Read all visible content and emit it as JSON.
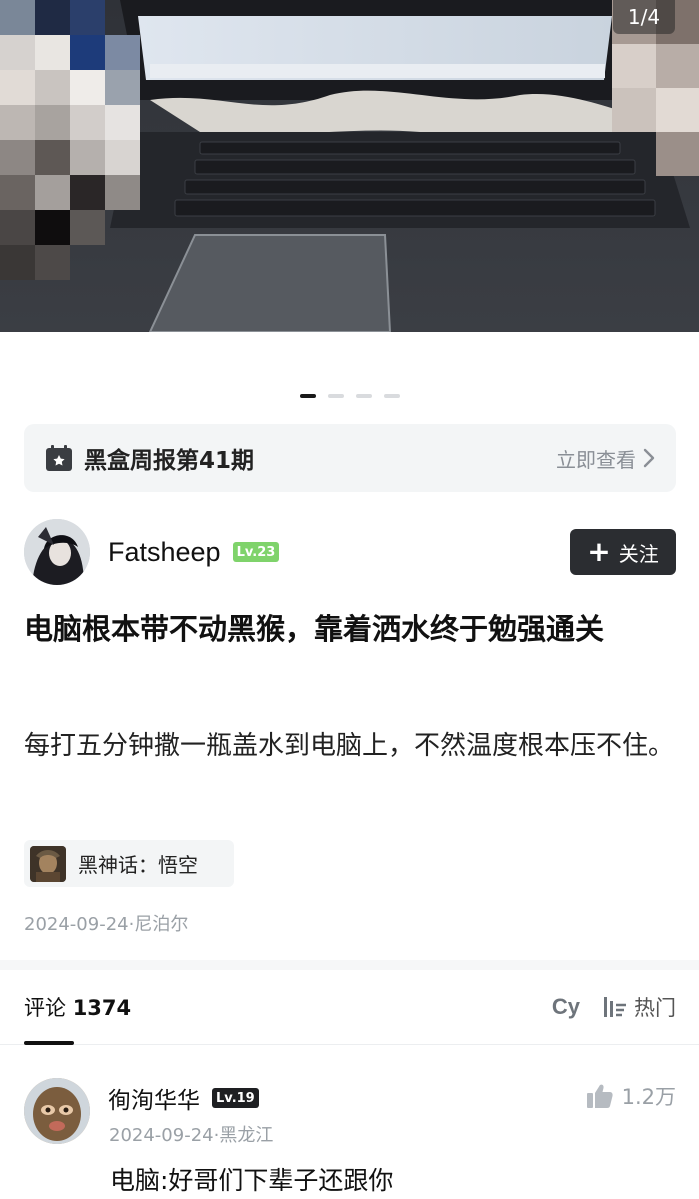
{
  "gallery": {
    "counter": "1/4",
    "dot_count": 4,
    "active_dot": 0
  },
  "banner": {
    "title": "黑盒周报第41期",
    "link": "立即查看"
  },
  "author": {
    "name": "Fatsheep",
    "level": "Lv.23",
    "follow_label": "关注"
  },
  "post": {
    "title": "电脑根本带不动黑猴，靠着洒水终于勉强通关",
    "body": "每打五分钟撒一瓶盖水到电脑上，不然温度根本压不住。",
    "game_tag": "黑神话：悟空",
    "meta": "2024-09-24·尼泊尔"
  },
  "comments": {
    "label": "评论",
    "count": "1374",
    "cy_icon": "Cy",
    "sort_label": "热门",
    "items": [
      {
        "user": "徇洵华华",
        "level": "Lv.19",
        "meta": "2024-09-24·黑龙江",
        "text": "电脑:好哥们下辈子还跟你",
        "likes": "1.2万"
      }
    ]
  }
}
